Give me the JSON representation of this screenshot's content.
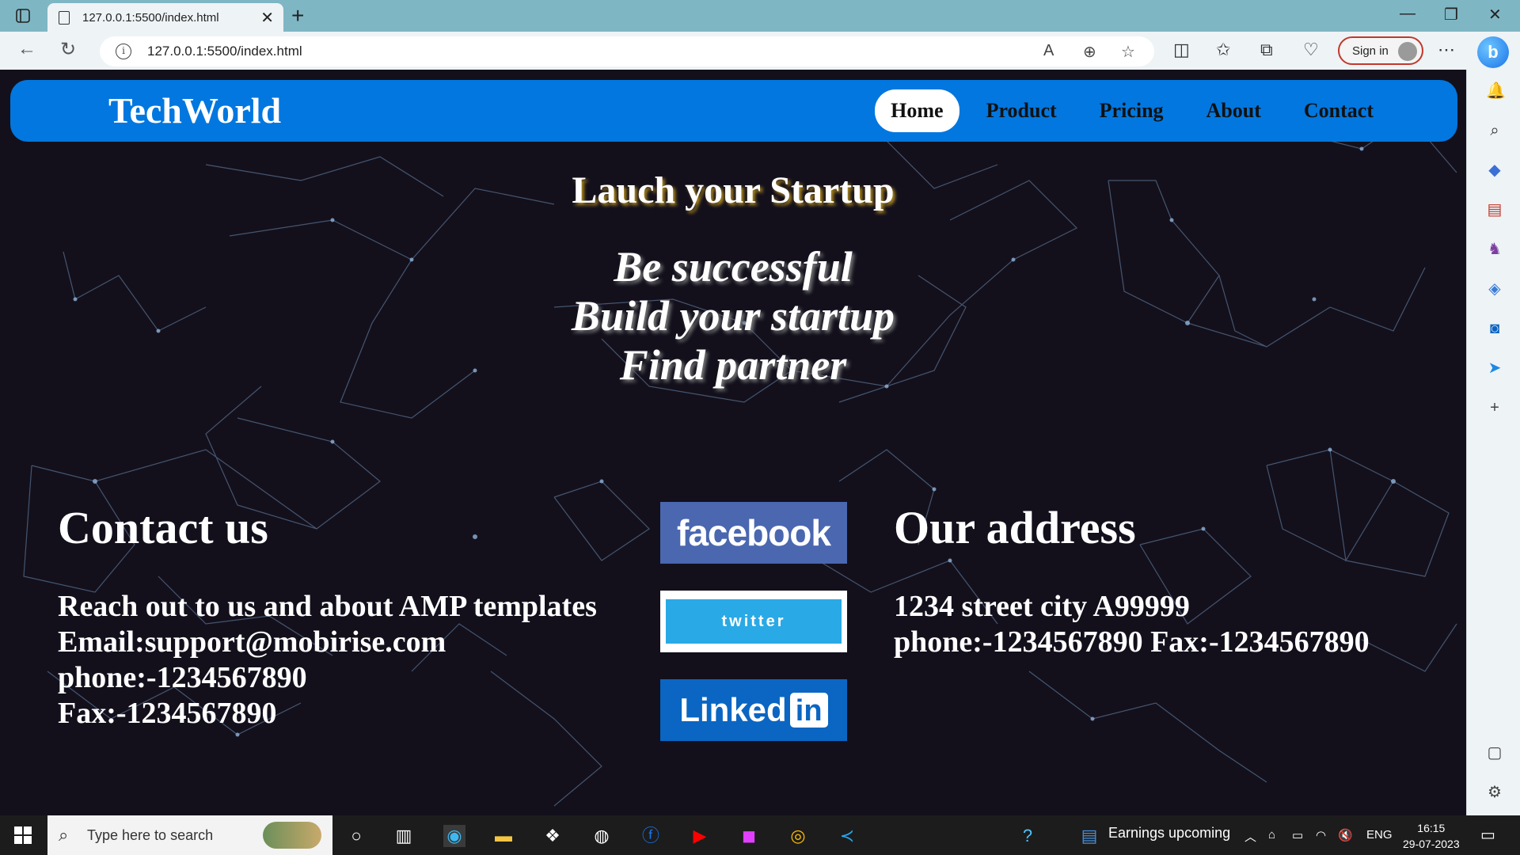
{
  "browser": {
    "tab_title": "127.0.0.1:5500/index.html",
    "url": "127.0.0.1:5500/index.html",
    "signin_label": "Sign in"
  },
  "site": {
    "brand": "TechWorld",
    "nav": [
      "Home",
      "Product",
      "Pricing",
      "About",
      "Contact"
    ],
    "active_nav": "Home",
    "hero_title": "Lauch your Startup",
    "hero_lines": [
      "Be successful",
      "Build your startup",
      "Find partner"
    ],
    "contact": {
      "heading": "Contact us",
      "lines": [
        "Reach out to us and about AMP templates",
        "Email:support@mobirise.com",
        "phone:-1234567890",
        "Fax:-1234567890"
      ]
    },
    "social": {
      "facebook": "facebook",
      "twitter": "twitter",
      "linkedin_word": "Linked",
      "linkedin_box": "in"
    },
    "address": {
      "heading": "Our address",
      "lines": [
        "1234 street city A99999",
        "phone:-1234567890 Fax:-1234567890"
      ]
    },
    "colors": {
      "navbar": "#0277df",
      "background": "#13101c",
      "facebook": "#4a67b0",
      "twitter": "#29a9e6",
      "linkedin": "#0a66c2"
    }
  },
  "taskbar": {
    "search_placeholder": "Type here to search",
    "weather_label": "Earnings upcoming",
    "language": "ENG",
    "time": "16:15",
    "date": "29-07-2023"
  }
}
